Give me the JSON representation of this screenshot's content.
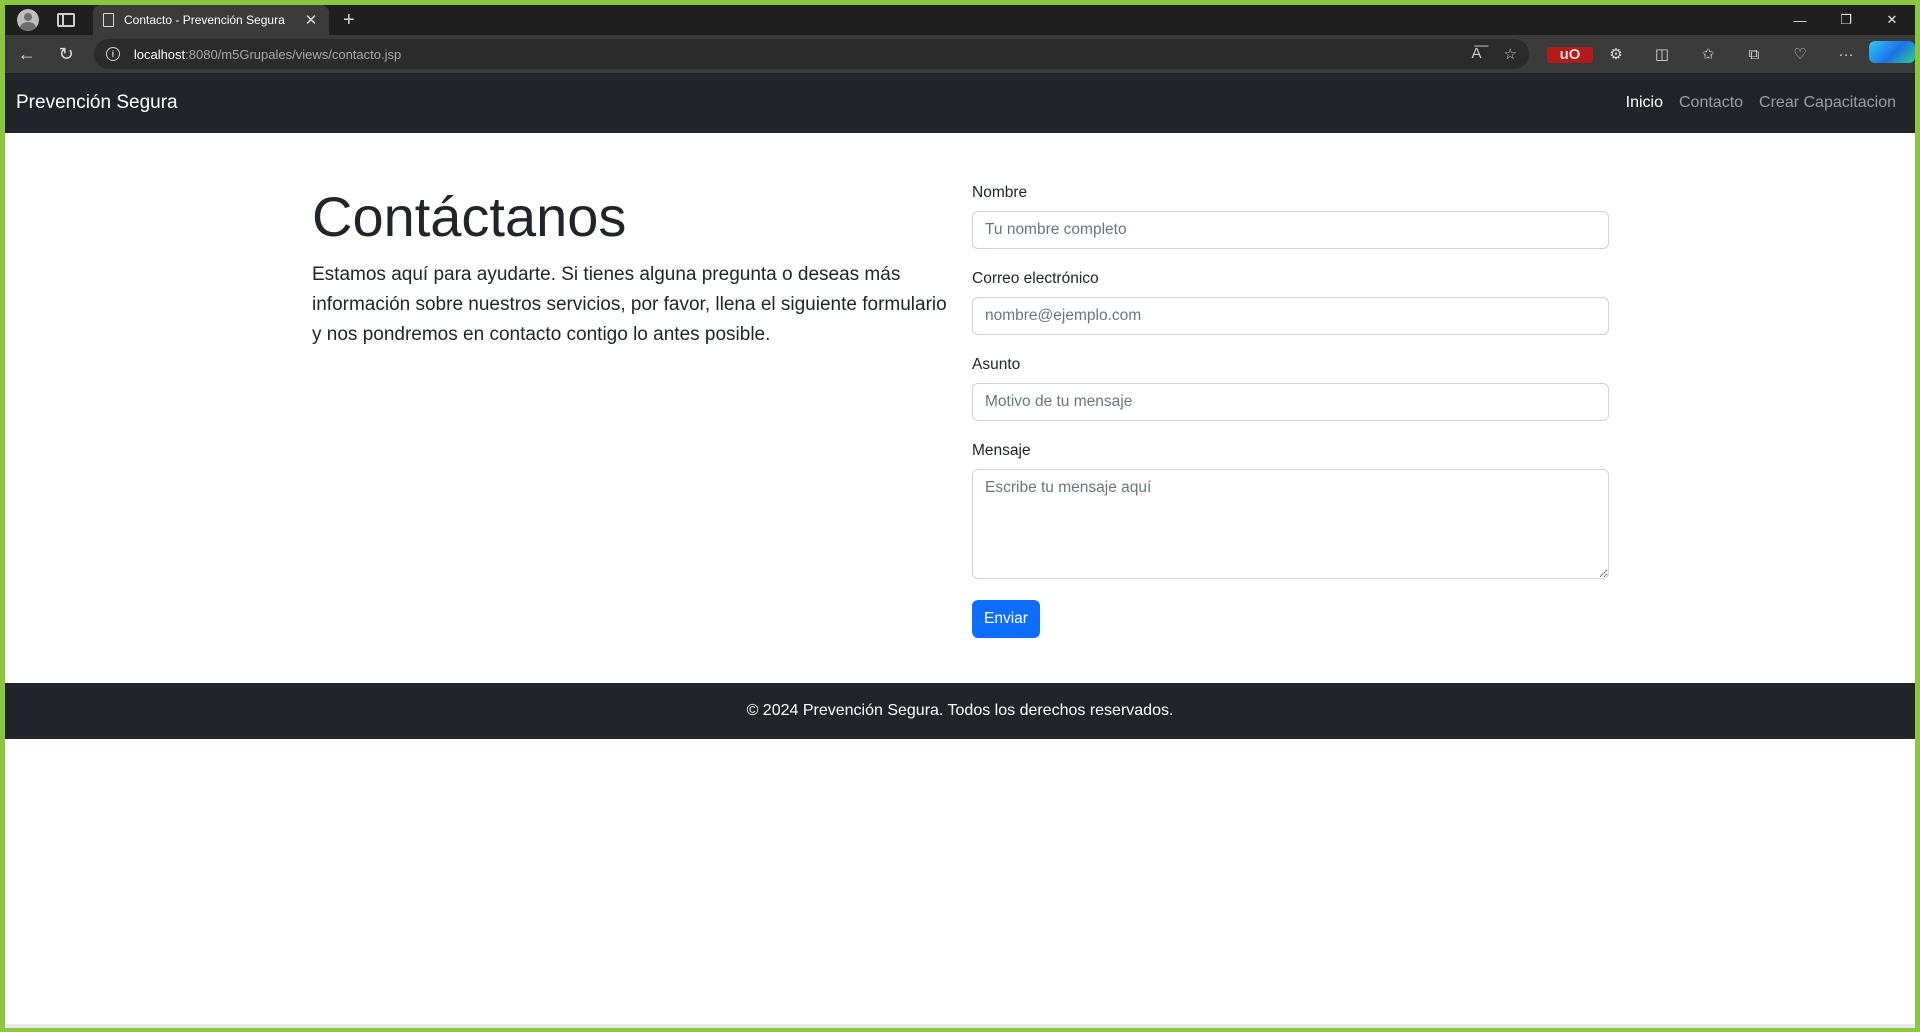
{
  "browser": {
    "tab_title": "Contacto - Prevención Segura",
    "tab_close": "✕",
    "new_tab": "+",
    "url_host": "localhost",
    "url_rest": ":8080/m5Grupales/views/contacto.jsp",
    "window_controls": {
      "minimize": "—",
      "restore": "❐",
      "close": "✕"
    },
    "icons": [
      "read-aloud-icon",
      "favorite-star-icon",
      "ublock-icon",
      "extensions-icon",
      "split-screen-icon",
      "favorites-icon",
      "collections-icon",
      "browser-essentials-icon",
      "more-icon",
      "copilot-icon"
    ],
    "ublock_label": "uO"
  },
  "navbar": {
    "brand": "Prevención Segura",
    "links": [
      {
        "label": "Inicio",
        "active": true
      },
      {
        "label": "Contacto",
        "active": false
      },
      {
        "label": "Crear Capacitacion",
        "active": false
      }
    ]
  },
  "intro": {
    "title": "Contáctanos",
    "text": "Estamos aquí para ayudarte. Si tienes alguna pregunta o deseas más información sobre nuestros servicios, por favor, llena el siguiente formulario y nos pondremos en contacto contigo lo antes posible."
  },
  "form": {
    "nombre": {
      "label": "Nombre",
      "placeholder": "Tu nombre completo",
      "value": ""
    },
    "correo": {
      "label": "Correo electrónico",
      "placeholder": "nombre@ejemplo.com",
      "value": ""
    },
    "asunto": {
      "label": "Asunto",
      "placeholder": "Motivo de tu mensaje",
      "value": ""
    },
    "mensaje": {
      "label": "Mensaje",
      "placeholder": "Escribe tu mensaje aquí",
      "value": ""
    },
    "submit_label": "Enviar"
  },
  "footer": {
    "text": "© 2024 Prevención Segura. Todos los derechos reservados."
  },
  "colors": {
    "navbar_bg": "#212529",
    "primary": "#0d6efd",
    "window_border": "#8cc63f"
  }
}
